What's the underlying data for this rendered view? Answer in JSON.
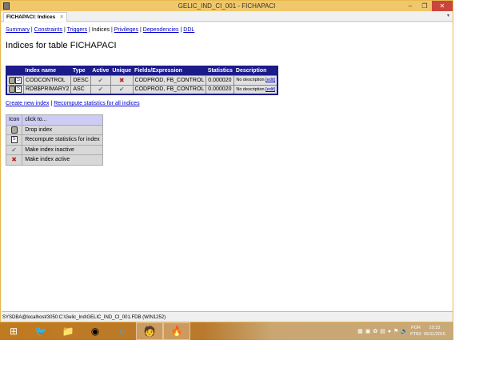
{
  "window": {
    "title": "GELIC_IND_CI_001 - FICHAPACI",
    "minimize": "–",
    "maximize": "❐",
    "close": "✕"
  },
  "tab": {
    "label": "FICHAPACI: Indices",
    "close": "✕",
    "menu": "▾"
  },
  "nav": {
    "links": [
      "Summary",
      "Constraints",
      "Triggers",
      "Indices",
      "Privileges",
      "Dependencies",
      "DDL"
    ],
    "sep": " | "
  },
  "heading": "Indices for table FICHAPACI",
  "indices": {
    "headers": [
      "",
      "Index name",
      "Type",
      "Active",
      "Unique",
      "Fields/Expression",
      "Statistics",
      "Description"
    ],
    "rows": [
      {
        "name": "CODCONTROL",
        "type": "DESC",
        "active": "✔",
        "unique": "✖",
        "fields": "CODPROD, FB_CONTROL",
        "stats": "0.000020",
        "desc": "No description",
        "edit": "[edit]"
      },
      {
        "name": "RDB$PRIMARY2",
        "type": "ASC",
        "active": "✔",
        "unique": "✔",
        "fields": "CODPROD, FB_CONTROL",
        "stats": "0.000020",
        "desc": "No description",
        "edit": "[edit]"
      }
    ]
  },
  "actions": {
    "create": "Create new index",
    "sep": " | ",
    "recompute": "Recompute statistics for all indices"
  },
  "legend": {
    "header_icon": "Icon",
    "header_text": "click to...",
    "items": [
      "Drop index",
      "Recompute statistics for index",
      "Make index inactive",
      "Make index active"
    ]
  },
  "status": "SYSDBA@localhost/3050:C:\\Gelic_Ind\\GELIC_IND_CI_001.FDB (WIN1252)",
  "taskbar": {
    "lang1": "POR",
    "lang2": "PTB2",
    "time": "10:33",
    "date": "06/11/2015"
  }
}
